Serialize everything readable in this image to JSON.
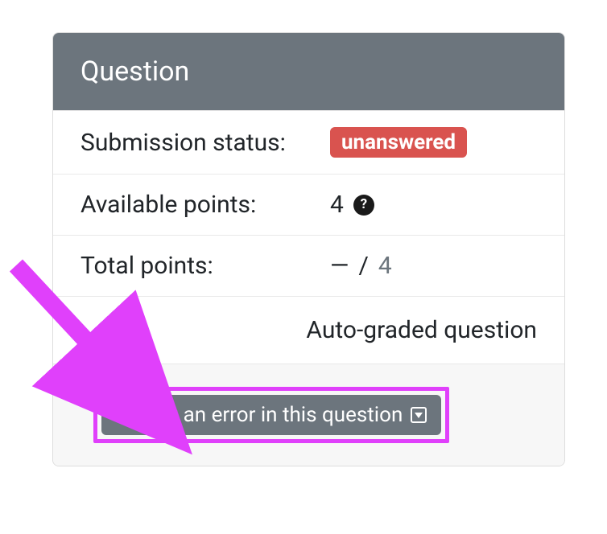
{
  "card": {
    "title": "Question",
    "rows": {
      "submission": {
        "label": "Submission status:",
        "badge": "unanswered"
      },
      "available": {
        "label": "Available points:",
        "value": "4"
      },
      "total": {
        "label": "Total points:",
        "dash": "—",
        "slash": " /",
        "max": "4"
      },
      "auto_graded": "Auto-graded question"
    },
    "footer": {
      "report_button": "Report an error in this question"
    }
  },
  "colors": {
    "header_bg": "#6c757d",
    "badge_bg": "#d9534f",
    "highlight": "#e040fb"
  }
}
